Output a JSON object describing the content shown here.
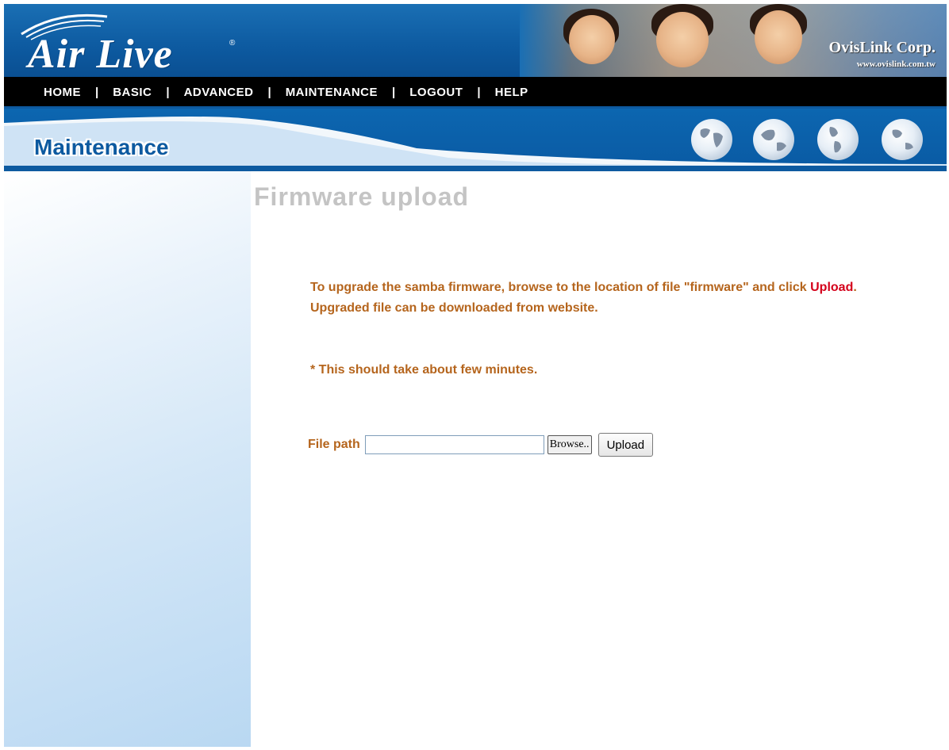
{
  "header": {
    "logo_text": "Air Live",
    "logo_reg": "®",
    "corp_name": "OvisLink Corp.",
    "corp_url": "www.ovislink.com.tw"
  },
  "nav": {
    "items": [
      {
        "label": "HOME"
      },
      {
        "label": "BASIC"
      },
      {
        "label": "ADVANCED"
      },
      {
        "label": "MAINTENANCE"
      },
      {
        "label": "LOGOUT"
      },
      {
        "label": "HELP"
      }
    ],
    "separator": "|"
  },
  "banner": {
    "section_title": "Maintenance"
  },
  "content": {
    "page_title": "Firmware upload",
    "description_part1": "To upgrade the samba firmware, browse to the location of file \"firmware\" and click ",
    "description_highlight": "Upload",
    "description_part2": ". Upgraded file can be downloaded from website.",
    "note": "* This should take about few minutes.",
    "file_label": "File path",
    "file_value": "",
    "browse_label": "Browse..",
    "upload_label": "Upload"
  },
  "colors": {
    "header_blue": "#0d5aa0",
    "nav_bg": "#000000",
    "text_orange": "#b5651d",
    "highlight_red": "#d4001a",
    "title_gray": "#c4c4c4"
  }
}
